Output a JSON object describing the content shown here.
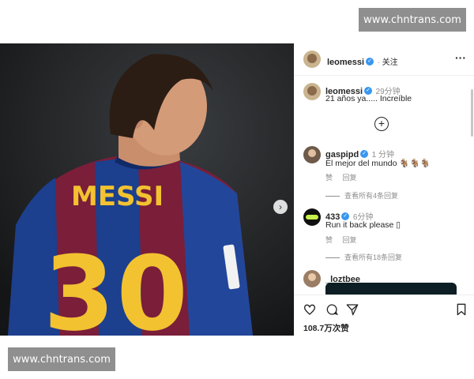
{
  "watermarks": {
    "top": "www.chntrans.com",
    "bottom": "www.chntrans.com"
  },
  "photo": {
    "jersey_name": "MESSI",
    "jersey_number": "30",
    "next_icon": "chevron-right-icon"
  },
  "post": {
    "author": "leomessi",
    "follow_label": "关注",
    "more_icon": "more-dots-icon",
    "caption": {
      "user": "leomessi",
      "time": "29分钟",
      "text": "21 años ya..... Increíble"
    },
    "load_more_icon": "plus-circle-icon",
    "comments": [
      {
        "user": "gaspipd",
        "time": "1 分钟",
        "text": "El mejor del mundo 🐐🐐🐐",
        "like_label": "赞",
        "reply_label": "回复",
        "view_replies": "查看所有4条回复"
      },
      {
        "user": "433",
        "time": "6分钟",
        "text": "Run it back please ▯",
        "like_label": "赞",
        "reply_label": "回复",
        "view_replies": "查看所有18条回复"
      },
      {
        "user": "_loztbee_"
      }
    ],
    "actions": {
      "like_icon": "heart-icon",
      "comment_icon": "comment-icon",
      "share_icon": "send-icon",
      "save_icon": "bookmark-icon"
    },
    "likes": "108.7万次赞"
  }
}
